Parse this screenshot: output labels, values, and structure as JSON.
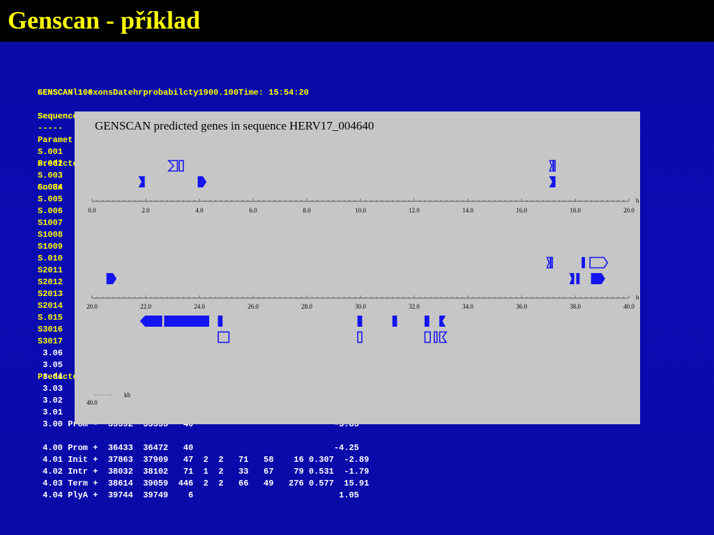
{
  "slide": {
    "title": "Genscan - příklad"
  },
  "overlay_texts": [
    "GENSCAN 1.0",
    "Sequence",
    "Predicted",
    "Gn.Ex",
    "Predicted"
  ],
  "text_lines": [
    {
      "text": "SENSCANl10exonsDatehrprobabilcty1900.100Time: 15:54:20",
      "color": "yellow"
    },
    {
      "text": "",
      "color": "yellow"
    },
    {
      "text": "Sequenc",
      "color": "yellow"
    },
    {
      "text": "-----",
      "color": "yellow"
    },
    {
      "text": "Paramet",
      "color": "yellow"
    },
    {
      "text": "S.001",
      "color": "yellow"
    },
    {
      "text": "S.002",
      "color": "yellow"
    },
    {
      "text": "S.003",
      "color": "yellow"
    },
    {
      "text": "S.004",
      "color": "yellow"
    },
    {
      "text": "S.005",
      "color": "yellow"
    },
    {
      "text": "S.006",
      "color": "yellow"
    },
    {
      "text": "S1007",
      "color": "yellow"
    },
    {
      "text": "S1008",
      "color": "yellow"
    },
    {
      "text": "S1009",
      "color": "yellow"
    },
    {
      "text": "S.010",
      "color": "yellow"
    },
    {
      "text": "S2011",
      "color": "yellow"
    },
    {
      "text": "S2012",
      "color": "yellow"
    },
    {
      "text": "S2013",
      "color": "yellow"
    },
    {
      "text": "S2014",
      "color": "yellow"
    },
    {
      "text": "S.015",
      "color": "yellow"
    },
    {
      "text": "S3016",
      "color": "yellow"
    },
    {
      "text": "S3017",
      "color": "yellow"
    },
    {
      "text": " 3.06",
      "color": "white"
    },
    {
      "text": " 3.05",
      "color": "white"
    },
    {
      "text": " 3.04",
      "color": "white"
    },
    {
      "text": " 3.03",
      "color": "white"
    },
    {
      "text": " 3.02",
      "color": "white"
    },
    {
      "text": " 3.01",
      "color": "white"
    },
    {
      "text": " 3.00 Prom -  35592  35553   40                            -5.85",
      "color": "white"
    },
    {
      "text": "",
      "color": "white"
    },
    {
      "text": " 4.00 Prom +  36433  36472   40                            -4.25",
      "color": "white"
    },
    {
      "text": " 4.01 Init +  37863  37909   47  2  2   71   58    16 0.307  -2.89",
      "color": "white"
    },
    {
      "text": " 4.02 Intr +  38032  38102   71  1  2   33   67    79 0.531  -1.79",
      "color": "white"
    },
    {
      "text": " 4.03 Term +  38614  39059  446  2  2   66   49   276 0.577  15.91",
      "color": "white"
    },
    {
      "text": " 4.04 PlyA +  39744  39749    6                             1.05",
      "color": "white"
    }
  ],
  "figure": {
    "title": "GENSCAN predicted genes in sequence HERV17_004640",
    "unit_label": "kb",
    "scale_note": "40.0",
    "axis_unit_suffix": "b",
    "tracks": [
      {
        "range": [
          0,
          20
        ],
        "ticks": [
          "0.0",
          "2.0",
          "4.0",
          "6.0",
          "8.0",
          "10.0",
          "12.0",
          "14.0",
          "16.0",
          "18.0",
          "20.0"
        ],
        "upper_features": [
          {
            "start": 2.85,
            "end": 3.4,
            "style": "outline",
            "shape": "term-rev"
          },
          {
            "start": 17.05,
            "end": 17.25,
            "style": "outline",
            "shape": "term-rev"
          }
        ],
        "lower_features": [
          {
            "start": 1.75,
            "end": 1.95,
            "style": "filled",
            "shape": "notch"
          },
          {
            "start": 3.95,
            "end": 4.25,
            "style": "filled",
            "shape": "arrow-right"
          },
          {
            "start": 17.05,
            "end": 17.25,
            "style": "filled",
            "shape": "notch"
          }
        ],
        "minus_features": [],
        "minus_outline_features": []
      },
      {
        "range": [
          20,
          40
        ],
        "ticks": [
          "20.0",
          "22.0",
          "24.0",
          "26.0",
          "28.0",
          "30.0",
          "32.0",
          "34.0",
          "36.0",
          "38.0",
          "40.0"
        ],
        "upper_features": [
          {
            "start": 36.95,
            "end": 37.15,
            "style": "outline",
            "shape": "term-rev"
          },
          {
            "start": 38.25,
            "end": 38.35,
            "style": "filled",
            "shape": "bar"
          },
          {
            "start": 38.55,
            "end": 39.2,
            "style": "outline",
            "shape": "arrow-right"
          }
        ],
        "lower_features": [
          {
            "start": 20.55,
            "end": 20.9,
            "style": "filled",
            "shape": "arrow-right"
          },
          {
            "start": 37.8,
            "end": 37.95,
            "style": "filled",
            "shape": "notch"
          },
          {
            "start": 38.05,
            "end": 38.15,
            "style": "filled",
            "shape": "bar"
          },
          {
            "start": 38.6,
            "end": 39.1,
            "style": "filled",
            "shape": "arrow-right"
          }
        ],
        "minus_features": [
          {
            "start": 21.8,
            "end": 22.6,
            "style": "filled",
            "shape": "arrow-left"
          },
          {
            "start": 22.7,
            "end": 24.35,
            "style": "filled",
            "shape": "bar"
          },
          {
            "start": 24.7,
            "end": 24.85,
            "style": "filled",
            "shape": "bar"
          },
          {
            "start": 29.9,
            "end": 30.05,
            "style": "filled",
            "shape": "bar"
          },
          {
            "start": 31.2,
            "end": 31.35,
            "style": "filled",
            "shape": "bar"
          },
          {
            "start": 32.4,
            "end": 32.55,
            "style": "filled",
            "shape": "bar"
          },
          {
            "start": 32.95,
            "end": 33.15,
            "style": "filled",
            "shape": "notch-left"
          }
        ],
        "minus_outline_features": [
          {
            "start": 24.7,
            "end": 25.1,
            "style": "outline",
            "shape": "bar"
          },
          {
            "start": 29.9,
            "end": 30.05,
            "style": "outline",
            "shape": "bar"
          },
          {
            "start": 32.4,
            "end": 32.6,
            "style": "outline",
            "shape": "bar"
          },
          {
            "start": 32.75,
            "end": 32.85,
            "style": "outline",
            "shape": "bar"
          },
          {
            "start": 32.95,
            "end": 33.2,
            "style": "outline",
            "shape": "notch-left"
          }
        ]
      }
    ]
  }
}
